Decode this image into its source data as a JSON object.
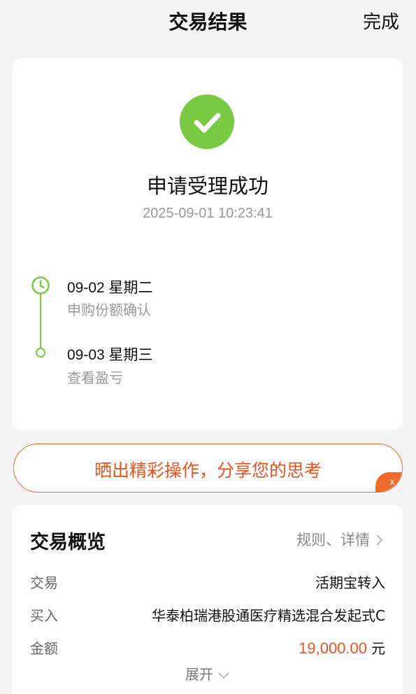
{
  "header": {
    "title": "交易结果",
    "done_label": "完成"
  },
  "result": {
    "title": "申请受理成功",
    "timestamp": "2025-09-01 10:23:41",
    "icon": "check-circle-icon",
    "accent_color": "#7ac943"
  },
  "timeline": [
    {
      "date": "09-02  星期二",
      "desc": "申购份额确认",
      "icon": "clock-icon"
    },
    {
      "date": "09-03  星期三",
      "desc": "查看盈亏",
      "icon": "dot-icon"
    }
  ],
  "share_banner": {
    "text": "晒出精彩操作，分享您的思考",
    "close_label": "x",
    "color": "#e9531e"
  },
  "overview": {
    "title": "交易概览",
    "link_label": "规则、详情",
    "rows": [
      {
        "label": "交易",
        "value": "活期宝转入"
      },
      {
        "label": "买入",
        "value": "华泰柏瑞港股通医疗精选混合发起式C"
      },
      {
        "label": "金额",
        "value": "19,000.00",
        "unit": "元"
      }
    ],
    "expand_label": "展开"
  }
}
